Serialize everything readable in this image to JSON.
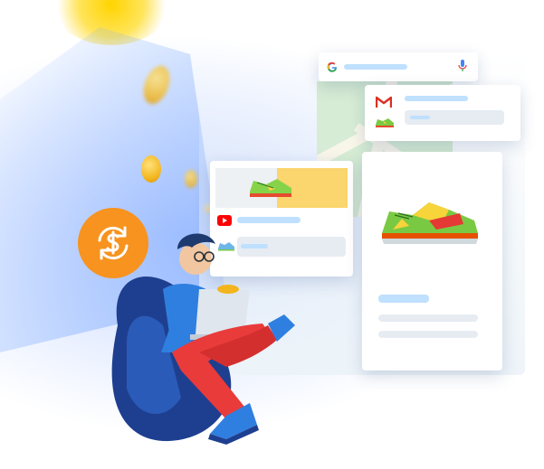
{
  "illustration": {
    "search_card": {
      "icon": "google-g-icon",
      "mic_icon": "microphone-icon"
    },
    "gmail_card": {
      "icon": "gmail-m-icon"
    },
    "youtube_card": {
      "icon": "youtube-play-icon"
    },
    "product_card": {
      "image": "sneaker-image"
    },
    "badge": {
      "icon": "dollar-refresh-icon"
    },
    "colors": {
      "beam_blue": "#3a70f0",
      "coin_gold": "#f3b51d",
      "badge_orange": "#f7931e",
      "shirt_blue": "#2f7fe0",
      "pants_red": "#ea3b3b",
      "chair_navy": "#1e3f8f"
    }
  }
}
